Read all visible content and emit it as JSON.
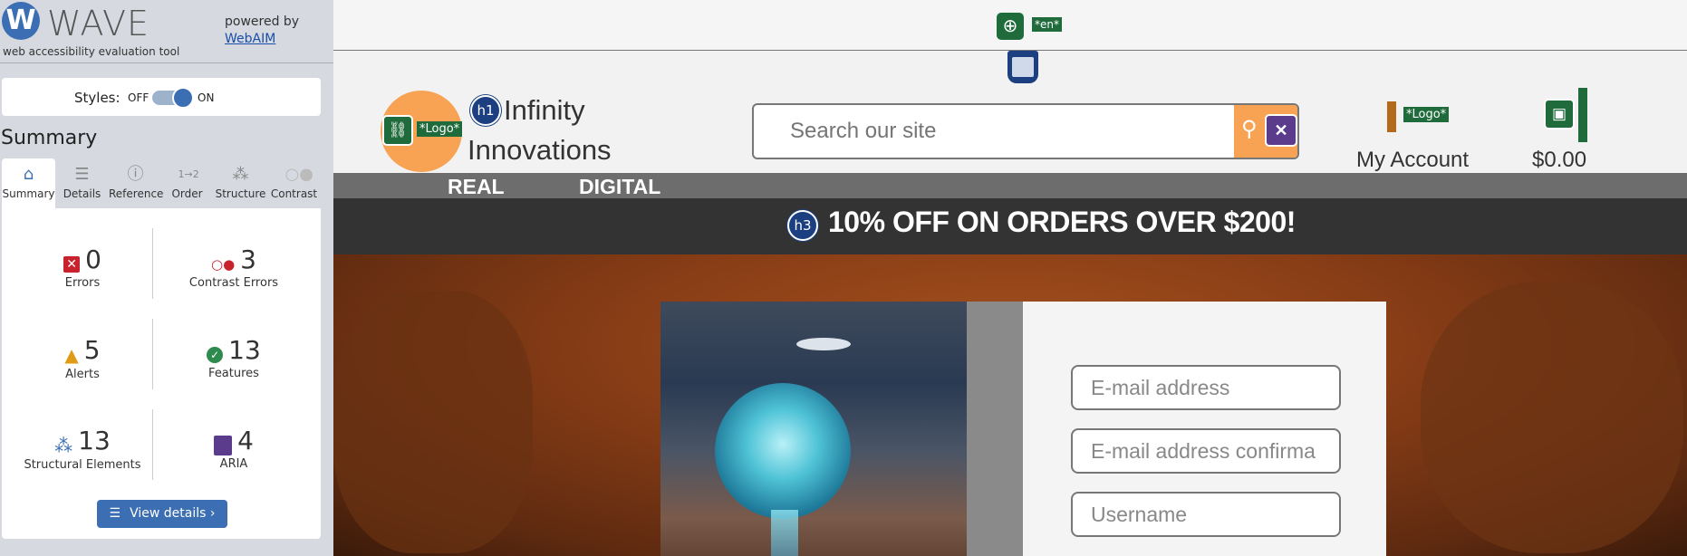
{
  "wave": {
    "logo_letter": "W",
    "title": "WAVE",
    "subtitle": "web accessibility evaluation tool",
    "powered_by": "powered by",
    "webaim_link": "WebAIM",
    "styles_label": "Styles:",
    "toggle_off": "OFF",
    "toggle_on": "ON",
    "summary_heading": "Summary",
    "tabs": [
      {
        "label": "Summary",
        "icon": "home-icon"
      },
      {
        "label": "Details",
        "icon": "list-icon"
      },
      {
        "label": "Reference",
        "icon": "info-icon"
      },
      {
        "label": "Order",
        "icon": "order-icon"
      },
      {
        "label": "Structure",
        "icon": "structure-icon"
      },
      {
        "label": "Contrast",
        "icon": "contrast-icon"
      }
    ],
    "stats": {
      "errors": {
        "count": "0",
        "label": "Errors"
      },
      "contrast_errors": {
        "count": "3",
        "label": "Contrast Errors"
      },
      "alerts": {
        "count": "5",
        "label": "Alerts"
      },
      "features": {
        "count": "13",
        "label": "Features"
      },
      "structural": {
        "count": "13",
        "label": "Structural Elements"
      },
      "aria": {
        "count": "4",
        "label": "ARIA"
      }
    },
    "view_details": "View details ›"
  },
  "site": {
    "lang_badge": "*en*",
    "logo_badge": "*Logo*",
    "h1_badge": "h1",
    "site_name": "Infinity Innovations",
    "search_placeholder": "Search our site",
    "account_logo_badge": "*Logo*",
    "account_label": "My Account",
    "cart_price": "$0.00",
    "nav": [
      "REAL",
      "DIGITAL"
    ],
    "h3_badge": "h3",
    "promo": "10% OFF ON ORDERS OVER $200!",
    "form": {
      "email_placeholder": "E-mail address",
      "email_confirm_placeholder": "E-mail address confirma",
      "username_placeholder": "Username"
    }
  },
  "colors": {
    "wave_blue": "#3b6eb3",
    "feature_green": "#1f6b3b",
    "aria_purple": "#5b3b8c",
    "brand_orange": "#f8a254",
    "promo_bg": "#333333"
  }
}
